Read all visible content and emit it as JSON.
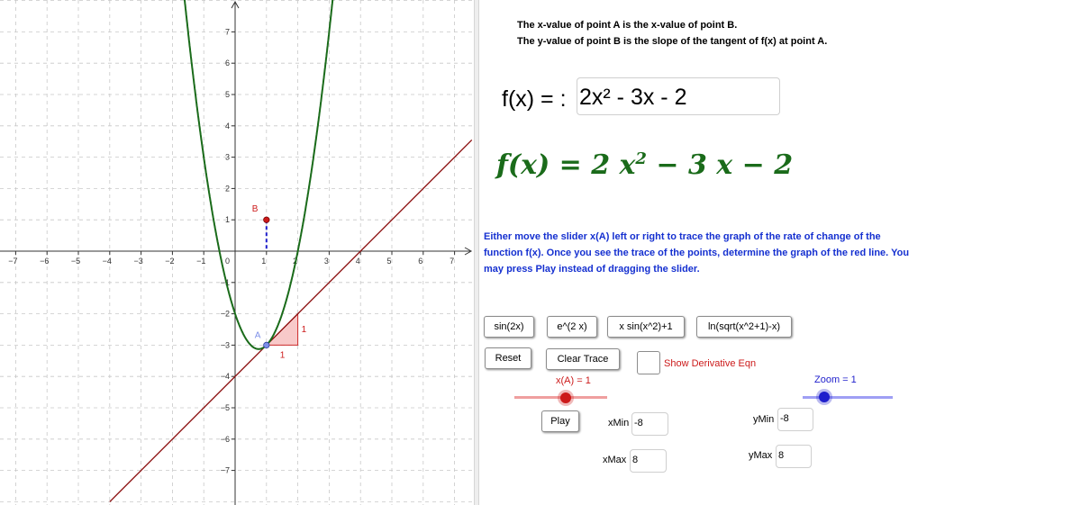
{
  "colors": {
    "curve": "#1a6b1a",
    "tangent": "#8b0e0e",
    "point_b": "#cc1a1a",
    "point_a": "#7d8fe8",
    "triangle_fill": "#f6b7b7",
    "triangle_stroke": "#cc2a2a",
    "instructions": "#1530d0",
    "x_slider": "#cc1a1a",
    "zoom_slider": "#1f1fcc"
  },
  "graph": {
    "x_ticks": [
      "−7",
      "−6",
      "−5",
      "−4",
      "−3",
      "−2",
      "−1",
      "1",
      "2",
      "3",
      "4",
      "5",
      "6",
      "7"
    ],
    "y_ticks_pos": [
      "1",
      "2",
      "3",
      "4",
      "5",
      "6",
      "7"
    ],
    "y_ticks_neg": [
      "−1",
      "−2",
      "−3",
      "−4",
      "−5",
      "−6",
      "−7"
    ],
    "origin_label": "0",
    "point_a_label": "A",
    "point_b_label": "B",
    "run_label": "1",
    "rise_label": "1",
    "point_a": {
      "x": 1,
      "y": -3
    },
    "point_b": {
      "x": 1,
      "y": 1
    },
    "function_coeffs": {
      "a": 2,
      "b": -3,
      "c": -2
    }
  },
  "description": {
    "line1": "The x-value of point A is the x-value of point B.",
    "line2": "The y-value of point B is the slope of the tangent of f(x) at point A."
  },
  "function_input": {
    "label": "f(x) = :",
    "value": "2x² - 3x - 2"
  },
  "function_display": {
    "lhs": "f(x) = 2 x",
    "exponent": "2",
    "rhs": " − 3 x − 2"
  },
  "instructions": "Either move the slider x(A) left or right to trace the graph of the rate of change of the function f(x). Once you see the trace of the points, determine the graph of the red line. You may press Play instead of dragging the slider.",
  "buttons": {
    "sin": "sin(2x)",
    "exp": "e^(2 x)",
    "xsin": "x sin(x^2)+1",
    "ln": "ln(sqrt(x^2+1)-x)",
    "reset": "Reset",
    "clear_trace": "Clear Trace",
    "play": "Play"
  },
  "checkbox": {
    "label": "Show Derivative Eqn",
    "checked": false
  },
  "x_slider": {
    "label": "x(A) = 1",
    "value": 1
  },
  "zoom_slider": {
    "label": "Zoom = 1",
    "value": 1
  },
  "fields": {
    "xmin_label": "xMin",
    "xmin_value": "-8",
    "xmax_label": "xMax",
    "xmax_value": "8",
    "ymin_label": "yMin",
    "ymin_value": "-8",
    "ymax_label": "yMax",
    "ymax_value": "8"
  }
}
